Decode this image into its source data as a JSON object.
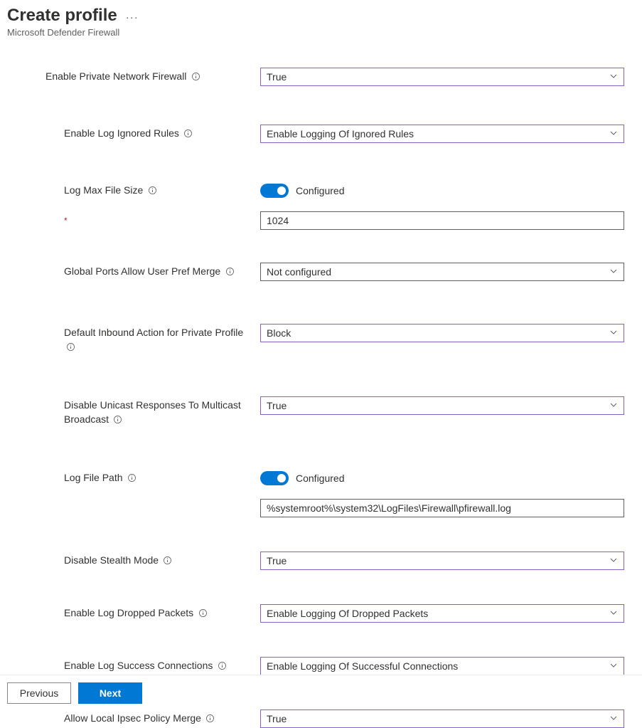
{
  "header": {
    "title": "Create profile",
    "subtitle": "Microsoft Defender Firewall",
    "more_icon": "more-icon"
  },
  "toggleText": "Configured",
  "settings": [
    {
      "key": "enable_private_firewall",
      "label": "Enable Private Network Firewall",
      "level": 0,
      "control": "select",
      "value": "True",
      "highlight": true,
      "info": true
    },
    {
      "key": "enable_log_ignored",
      "label": "Enable Log Ignored Rules",
      "level": 1,
      "control": "select",
      "value": "Enable Logging Of Ignored Rules",
      "highlight": true,
      "info": true
    },
    {
      "key": "log_max_file_size",
      "label": "Log Max File Size",
      "level": 1,
      "control": "toggle",
      "value": "Configured",
      "info": true
    },
    {
      "key": "log_max_file_size_value",
      "label": "",
      "level": 1,
      "control": "textinput",
      "value": "1024",
      "required": true
    },
    {
      "key": "global_ports_merge",
      "label": "Global Ports Allow User Pref Merge",
      "level": 1,
      "control": "select",
      "value": "Not configured",
      "highlight": false,
      "info": true
    },
    {
      "key": "default_inbound_private",
      "label": "Default Inbound Action for Private Profile",
      "level": 1,
      "control": "select",
      "value": "Block",
      "highlight": true,
      "info": true,
      "infoBelow": true
    },
    {
      "key": "disable_unicast_multicast",
      "label": "Disable Unicast Responses To Multicast Broadcast",
      "level": 1,
      "control": "select",
      "value": "True",
      "highlight": true,
      "info": true,
      "infoBelow": true
    },
    {
      "key": "log_file_path_toggle",
      "label": "Log File Path",
      "level": 1,
      "control": "toggle",
      "value": "Configured",
      "info": true
    },
    {
      "key": "log_file_path_value",
      "label": "",
      "level": 1,
      "control": "textinput",
      "value": "%systemroot%\\system32\\LogFiles\\Firewall\\pfirewall.log"
    },
    {
      "key": "disable_stealth_mode",
      "label": "Disable Stealth Mode",
      "level": 1,
      "control": "select",
      "value": "True",
      "highlight": true,
      "info": true
    },
    {
      "key": "enable_log_dropped",
      "label": "Enable Log Dropped Packets",
      "level": 1,
      "control": "select",
      "value": "Enable Logging Of Dropped Packets",
      "highlight": true,
      "info": true
    },
    {
      "key": "enable_log_success",
      "label": "Enable Log Success Connections",
      "level": 1,
      "control": "select",
      "value": "Enable Logging Of Successful Connections",
      "highlight": true,
      "info": true
    },
    {
      "key": "allow_local_ipsec_merge",
      "label": "Allow Local Ipsec Policy Merge",
      "level": 1,
      "control": "select",
      "value": "True",
      "highlight": true,
      "info": true
    }
  ],
  "spacing": {
    "enable_private_firewall": 0,
    "enable_log_ignored": 54,
    "log_max_file_size": 54,
    "log_max_file_size_value": 16,
    "global_ports_merge": 46,
    "default_inbound_private": 60,
    "disable_unicast_multicast": 60,
    "log_file_path_toggle": 60,
    "log_file_path_value": 16,
    "disable_stealth_mode": 48,
    "enable_log_dropped": 48,
    "enable_log_success": 48,
    "allow_local_ipsec_merge": 48
  },
  "footer": {
    "previous": "Previous",
    "next": "Next"
  }
}
